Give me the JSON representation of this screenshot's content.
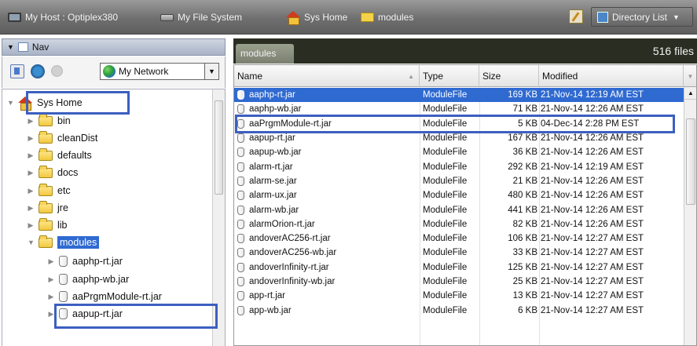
{
  "topbar": {
    "host": "My Host : Optiplex380",
    "filesystem": "My File System",
    "syshome": "Sys Home",
    "modules": "modules",
    "view": "Directory List"
  },
  "nav": {
    "header": "Nav",
    "network": "My Network",
    "tree": [
      {
        "label": "Sys Home",
        "icon": "house-icon",
        "level": 0,
        "expanded": true,
        "highlighted": true
      },
      {
        "label": "bin",
        "icon": "folder-icon",
        "level": 1
      },
      {
        "label": "cleanDist",
        "icon": "folder-icon",
        "level": 1
      },
      {
        "label": "defaults",
        "icon": "folder-icon",
        "level": 1
      },
      {
        "label": "docs",
        "icon": "folder-icon",
        "level": 1
      },
      {
        "label": "etc",
        "icon": "folder-icon",
        "level": 1
      },
      {
        "label": "jre",
        "icon": "folder-icon",
        "level": 1
      },
      {
        "label": "lib",
        "icon": "folder-icon",
        "level": 1
      },
      {
        "label": "modules",
        "icon": "folder-icon",
        "level": 1,
        "expanded": true,
        "selected": true
      },
      {
        "label": "aaphp-rt.jar",
        "icon": "jar-icon",
        "level": 2
      },
      {
        "label": "aaphp-wb.jar",
        "icon": "jar-icon",
        "level": 2
      },
      {
        "label": "aaPrgmModule-rt.jar",
        "icon": "jar-icon",
        "level": 2,
        "highlighted": true
      },
      {
        "label": "aapup-rt.jar",
        "icon": "jar-icon",
        "level": 2
      }
    ]
  },
  "files": {
    "tab": "modules",
    "count": "516 files",
    "columns": [
      "Name",
      "Type",
      "Size",
      "Modified"
    ],
    "rows": [
      {
        "name": "aaphp-rt.jar",
        "type": "ModuleFile",
        "size": "169 KB",
        "modified": "21-Nov-14 12:19 AM EST",
        "selected": true
      },
      {
        "name": "aaphp-wb.jar",
        "type": "ModuleFile",
        "size": "71 KB",
        "modified": "21-Nov-14 12:26 AM EST"
      },
      {
        "name": "aaPrgmModule-rt.jar",
        "type": "ModuleFile",
        "size": "5 KB",
        "modified": "04-Dec-14 2:28 PM EST",
        "highlighted": true
      },
      {
        "name": "aapup-rt.jar",
        "type": "ModuleFile",
        "size": "167 KB",
        "modified": "21-Nov-14 12:26 AM EST"
      },
      {
        "name": "aapup-wb.jar",
        "type": "ModuleFile",
        "size": "36 KB",
        "modified": "21-Nov-14 12:26 AM EST"
      },
      {
        "name": "alarm-rt.jar",
        "type": "ModuleFile",
        "size": "292 KB",
        "modified": "21-Nov-14 12:19 AM EST"
      },
      {
        "name": "alarm-se.jar",
        "type": "ModuleFile",
        "size": "21 KB",
        "modified": "21-Nov-14 12:26 AM EST"
      },
      {
        "name": "alarm-ux.jar",
        "type": "ModuleFile",
        "size": "480 KB",
        "modified": "21-Nov-14 12:26 AM EST"
      },
      {
        "name": "alarm-wb.jar",
        "type": "ModuleFile",
        "size": "441 KB",
        "modified": "21-Nov-14 12:26 AM EST"
      },
      {
        "name": "alarmOrion-rt.jar",
        "type": "ModuleFile",
        "size": "82 KB",
        "modified": "21-Nov-14 12:26 AM EST"
      },
      {
        "name": "andoverAC256-rt.jar",
        "type": "ModuleFile",
        "size": "106 KB",
        "modified": "21-Nov-14 12:27 AM EST"
      },
      {
        "name": "andoverAC256-wb.jar",
        "type": "ModuleFile",
        "size": "33 KB",
        "modified": "21-Nov-14 12:27 AM EST"
      },
      {
        "name": "andoverInfinity-rt.jar",
        "type": "ModuleFile",
        "size": "125 KB",
        "modified": "21-Nov-14 12:27 AM EST"
      },
      {
        "name": "andoverInfinity-wb.jar",
        "type": "ModuleFile",
        "size": "25 KB",
        "modified": "21-Nov-14 12:27 AM EST"
      },
      {
        "name": "app-rt.jar",
        "type": "ModuleFile",
        "size": "13 KB",
        "modified": "21-Nov-14 12:27 AM EST"
      },
      {
        "name": "app-wb.jar",
        "type": "ModuleFile",
        "size": "6 KB",
        "modified": "21-Nov-14 12:27 AM EST"
      }
    ]
  },
  "colors": {
    "selection": "#2f6ad1",
    "highlight_box": "#3c5fc0",
    "header_dark": "#2a2e22"
  }
}
